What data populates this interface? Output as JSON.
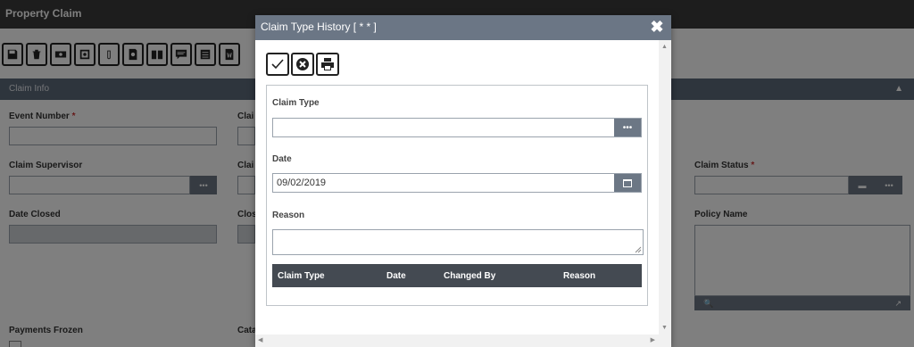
{
  "app": {
    "title": "Property Claim",
    "toolbar": [
      "save-icon",
      "delete-icon",
      "money-icon",
      "safe-icon",
      "attach-icon",
      "search-doc-icon",
      "book-icon",
      "comment-icon",
      "list-icon",
      "word-icon"
    ]
  },
  "section": {
    "title": "Claim Info"
  },
  "fields": {
    "event_number": {
      "label": "Event Number",
      "required": "*"
    },
    "claim_col": {
      "label": "Clai"
    },
    "claim_supervisor": {
      "label": "Claim Supervisor"
    },
    "claim_col2": {
      "label": "Clai"
    },
    "claim_status": {
      "label": "Claim Status",
      "required": "*"
    },
    "date_closed": {
      "label": "Date Closed"
    },
    "close_col": {
      "label": "Clos"
    },
    "policy_name": {
      "label": "Policy Name"
    },
    "payments_frozen": {
      "label": "Payments Frozen"
    },
    "cata_col": {
      "label": "Cata"
    }
  },
  "dialog": {
    "title": "Claim Type History [ * * ]",
    "close_glyph": "✖",
    "claim_type": {
      "label": "Claim Type",
      "value": "",
      "button": "•••"
    },
    "date": {
      "label": "Date",
      "value": "09/02/2019"
    },
    "reason": {
      "label": "Reason",
      "value": ""
    },
    "grid": {
      "columns": [
        "Claim Type",
        "Date",
        "Changed By",
        "Reason"
      ]
    }
  },
  "colors": {
    "header": "#3a3a3a",
    "section": "#5d6a7a",
    "dialog_title": "#6b7685",
    "grid_head": "#444a52"
  }
}
